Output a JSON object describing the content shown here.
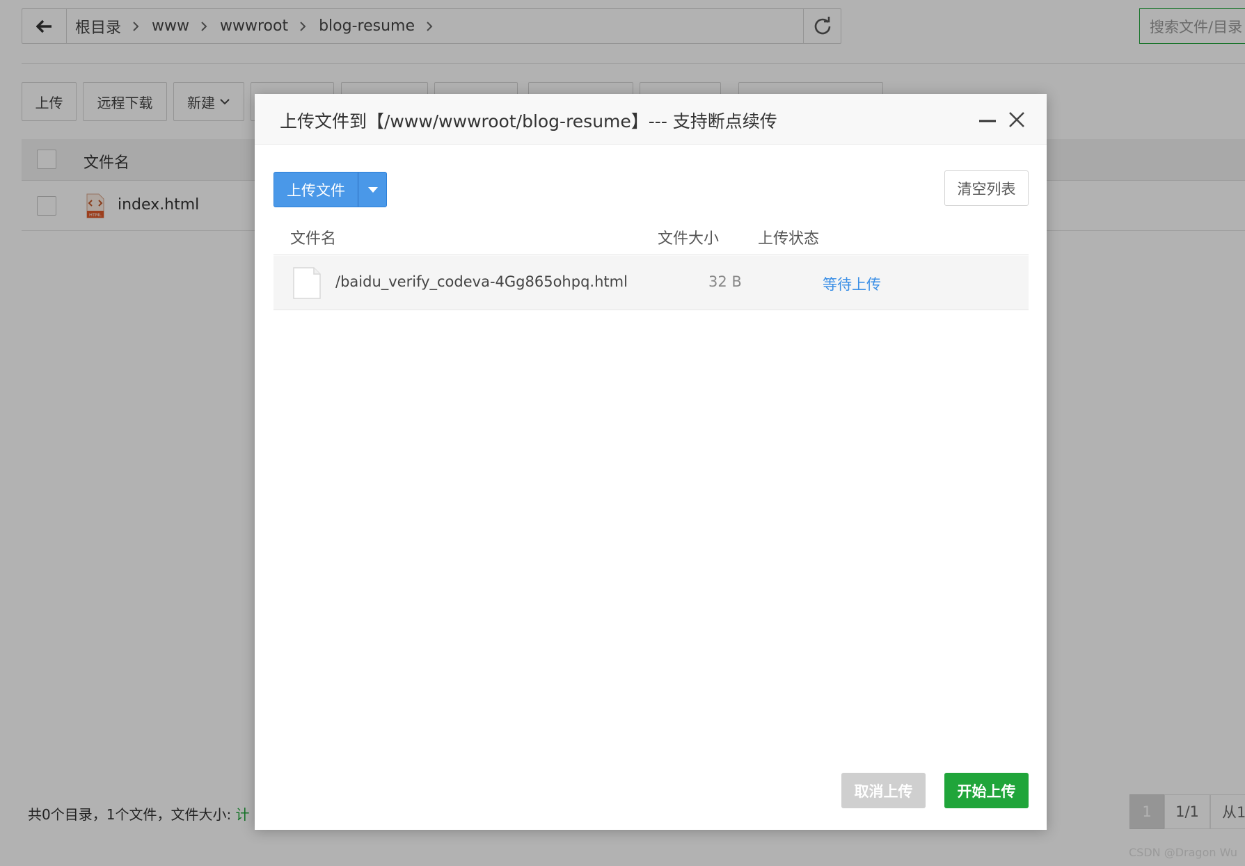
{
  "path_bar": {
    "crumbs": [
      "根目录",
      "www",
      "wwwroot",
      "blog-resume"
    ]
  },
  "search": {
    "placeholder": "搜索文件/目录"
  },
  "toolbar": {
    "upload_label": "上传",
    "remote_download_label": "远程下载",
    "new_label": "新建"
  },
  "file_list": {
    "header_name": "文件名",
    "rows": [
      {
        "name": "index.html",
        "icon": "html-file-icon"
      }
    ]
  },
  "footer": {
    "summary": "共0个目录，1个文件，文件大小: ",
    "calc_link": "计"
  },
  "pagination": {
    "current": "1",
    "total": "1/1",
    "from": "从1"
  },
  "watermark": "CSDN @Dragon   Wu",
  "dialog": {
    "title": "上传文件到【/www/wwwroot/blog-resume】--- 支持断点续传",
    "upload_button": "上传文件",
    "clear_button": "清空列表",
    "columns": {
      "name": "文件名",
      "size": "文件大小",
      "status": "上传状态"
    },
    "files": [
      {
        "name": "/baidu_verify_codeva-4Gg865ohpq.html",
        "size": "32 B",
        "status": "等待上传"
      }
    ],
    "cancel_button": "取消上传",
    "start_button": "开始上传"
  },
  "colors": {
    "primary_blue": "#4a98e8",
    "success_green": "#20a53a",
    "status_blue": "#3b8fe6",
    "disabled_gray": "#cfcfcf"
  }
}
